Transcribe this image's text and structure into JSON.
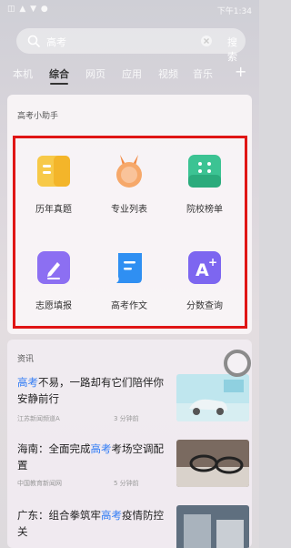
{
  "status_bar": {
    "left": "◫ ▲ ▼ ●",
    "time": "下午1:34"
  },
  "search": {
    "value": "高考",
    "button": "搜索"
  },
  "tabs": [
    {
      "label": "本机",
      "active": false
    },
    {
      "label": "综合",
      "active": true
    },
    {
      "label": "网页",
      "active": false
    },
    {
      "label": "应用",
      "active": false
    },
    {
      "label": "视频",
      "active": false
    },
    {
      "label": "音乐",
      "active": false
    }
  ],
  "assistant": {
    "title": "高考小助手",
    "tools": [
      {
        "label": "历年真题",
        "icon": "document-folder-icon",
        "color": "#f5c23a"
      },
      {
        "label": "专业列表",
        "icon": "medal-icon",
        "color": "#f59c5b"
      },
      {
        "label": "院校榜单",
        "icon": "school-ranking-icon",
        "color": "#3dc08e"
      },
      {
        "label": "志愿填报",
        "icon": "edit-pen-icon",
        "color": "#8a6cf0"
      },
      {
        "label": "高考作文",
        "icon": "essay-scroll-icon",
        "color": "#2e8ef0"
      },
      {
        "label": "分数查询",
        "icon": "score-query-icon",
        "color": "#7c63ee"
      }
    ]
  },
  "news": {
    "title": "资讯",
    "items": [
      {
        "title_pre": "",
        "title_hl": "高考",
        "title_post": "不易，一路却有它们陪伴你安静前行",
        "source": "江苏新闻频道A",
        "comments": "3 分钟前"
      },
      {
        "title_pre": "海南：全面完成",
        "title_hl": "高考",
        "title_post": "考场空调配置",
        "source": "中国教育新闻网",
        "comments": "5 分钟前"
      },
      {
        "title_pre": "广东：组合拳筑牢",
        "title_hl": "高考",
        "title_post": "疫情防控关",
        "source": "",
        "comments": ""
      }
    ]
  }
}
